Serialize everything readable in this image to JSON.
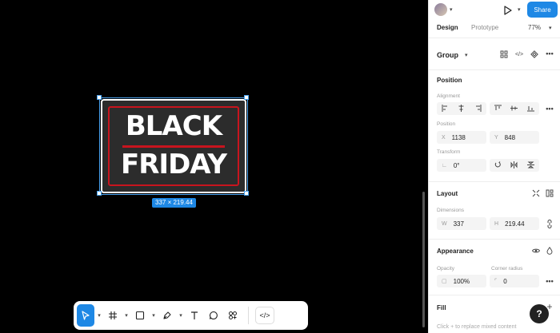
{
  "artwork": {
    "line1": "BLACK",
    "line2": "FRIDAY",
    "size_label": "337 × 219.44",
    "colors": {
      "background": "#2c2c2c",
      "frame": "#c8141e",
      "text": "#ffffff",
      "selection": "#4aa3f0"
    }
  },
  "topbar": {
    "share_label": "Share",
    "play_icon": "play-icon"
  },
  "tabs": {
    "design": "Design",
    "prototype": "Prototype",
    "zoom": "77%"
  },
  "group": {
    "title": "Group"
  },
  "position": {
    "title": "Position",
    "alignment_label": "Alignment",
    "position_label": "Position",
    "x_key": "X",
    "x_value": "1138",
    "y_key": "Y",
    "y_value": "848",
    "transform_label": "Transform",
    "rotation_value": "0°"
  },
  "layout": {
    "title": "Layout",
    "dimensions_label": "Dimensions",
    "w_key": "W",
    "w_value": "337",
    "h_key": "H",
    "h_value": "219.44"
  },
  "appearance": {
    "title": "Appearance",
    "opacity_label": "Opacity",
    "opacity_value": "100%",
    "radius_label": "Corner radius",
    "radius_value": "0"
  },
  "fill": {
    "title": "Fill",
    "hint": "Click + to replace mixed content"
  },
  "help": {
    "label": "?"
  },
  "accent_color": "#1e88e5"
}
